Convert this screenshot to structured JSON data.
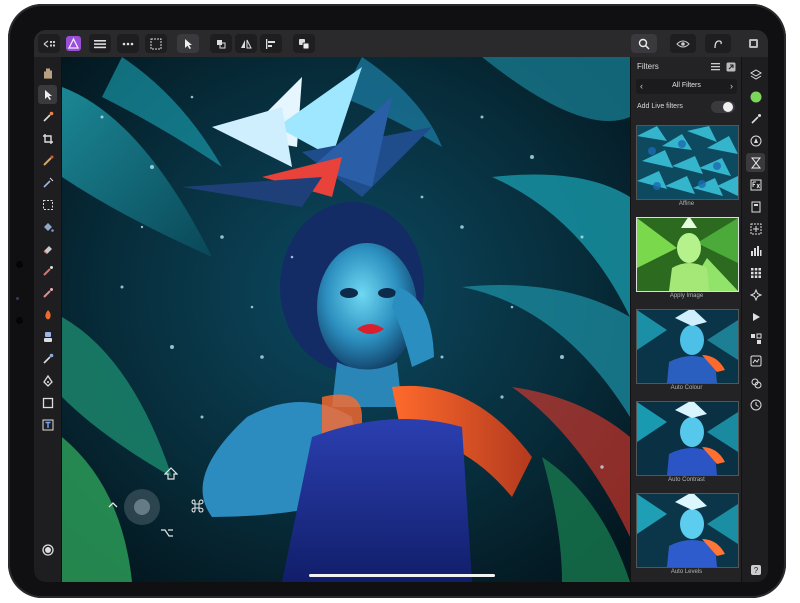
{
  "app": {
    "name": "Affinity Photo"
  },
  "top_toolbar": {
    "left_icons": [
      "back-grid-icon",
      "affinity-persona-icon",
      "menu-icon",
      "more-icon",
      "document-grid-icon"
    ],
    "middle_icons": [
      "pointer-icon",
      "transform-icon",
      "flip-icon",
      "align-icon",
      "arrange-icon"
    ],
    "right_icons": [
      "search-icon",
      "eye-icon",
      "hand-swirl-icon",
      "view-icon"
    ]
  },
  "tools": [
    "hand-icon",
    "move-icon",
    "eyedropper-icon",
    "crop-icon",
    "paint-brush-icon",
    "selection-brush-icon",
    "marquee-icon",
    "flood-fill-icon",
    "erase-icon",
    "gradient-icon",
    "clone-icon",
    "burn-icon",
    "blur-icon",
    "smudge-icon",
    "pen-icon",
    "rectangle-icon",
    "text-icon"
  ],
  "filters_panel": {
    "title": "Filters",
    "category": "All Filters",
    "add_live_label": "Add Live filters",
    "add_live_on": false,
    "items": [
      {
        "label": "Affine"
      },
      {
        "label": "Apply Image"
      },
      {
        "label": "Auto Colour"
      },
      {
        "label": "Auto Contrast"
      },
      {
        "label": "Auto Levels"
      }
    ]
  },
  "studio_icons": [
    "layers-icon",
    "colour-icon",
    "brush-icon",
    "navigator-icon",
    "history-icon",
    "fx-icon",
    "channels-icon",
    "transform-icon",
    "histogram-icon",
    "swatches-icon",
    "stock-icon",
    "macro-icon",
    "adjustments-icon",
    "assets-icon",
    "time-icon",
    "help-icon"
  ],
  "colors": {
    "accent_green": "#7dd65c",
    "panel": "#232326",
    "toolbar": "#2a2a2d"
  }
}
